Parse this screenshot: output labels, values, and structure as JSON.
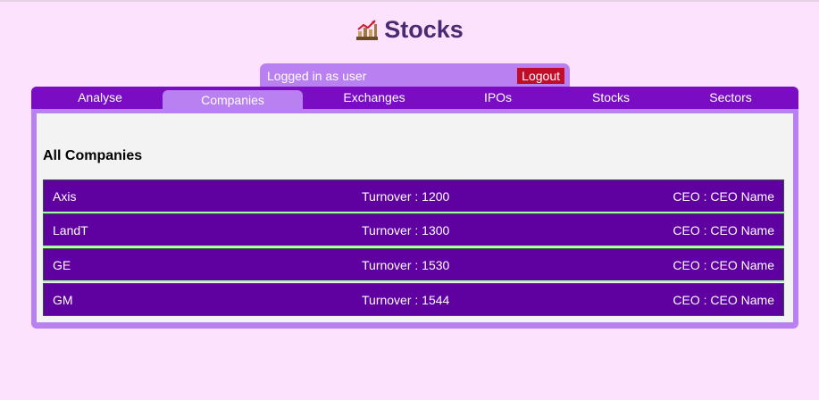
{
  "app": {
    "title": "Stocks",
    "logo_icon": "stock-chart-icon"
  },
  "user_bar": {
    "logged_in_text": "Logged in as user",
    "logout_label": "Logout"
  },
  "tabs": [
    {
      "label": "Analyse",
      "active": false
    },
    {
      "label": "Companies",
      "active": true
    },
    {
      "label": "Exchanges",
      "active": false
    },
    {
      "label": "IPOs",
      "active": false
    },
    {
      "label": "Stocks",
      "active": false
    },
    {
      "label": "Sectors",
      "active": false
    }
  ],
  "main": {
    "heading": "All Companies",
    "companies": [
      {
        "name": "Axis",
        "turnover": "Turnover : 1200",
        "ceo": "CEO : CEO Name"
      },
      {
        "name": "LandT",
        "turnover": "Turnover : 1300",
        "ceo": "CEO : CEO Name"
      },
      {
        "name": "GE",
        "turnover": "Turnover : 1530",
        "ceo": "CEO : CEO Name"
      },
      {
        "name": "GM",
        "turnover": "Turnover : 1544",
        "ceo": "CEO : CEO Name"
      }
    ]
  },
  "colors": {
    "background": "#fde2fd",
    "tab_bar": "#7a0cc3",
    "accent_light": "#b980f1",
    "row_bg": "#5f00a0",
    "logout_bg": "#c00d2a",
    "title_color": "#4b2a72"
  }
}
